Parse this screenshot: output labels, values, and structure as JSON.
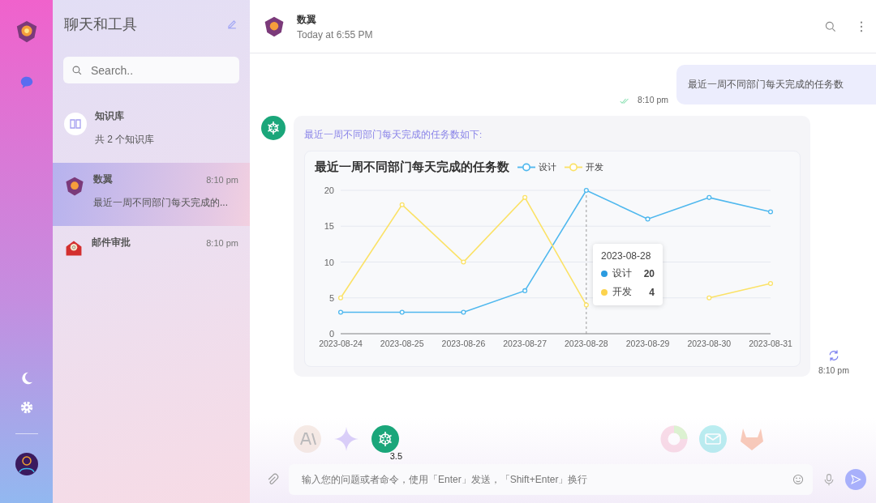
{
  "sidebar": {
    "title": "聊天和工具",
    "search": {
      "placeholder": "Search.."
    },
    "items": [
      {
        "kind": "knowledge",
        "title": "知识库",
        "subtitle": "共 2 个知识库",
        "selected": false
      },
      {
        "kind": "bot",
        "title": "数翼",
        "time": "8:10 pm",
        "subtitle": "最近一周不同部门每天完成的...",
        "selected": true
      },
      {
        "kind": "mail",
        "title": "邮件审批",
        "time": "8:10 pm",
        "selected": false
      }
    ]
  },
  "header": {
    "title": "数翼",
    "subtitle": "Today at 6:55 PM"
  },
  "messages": [
    {
      "kind": "user",
      "text": "最近一周不同部门每天完成的任务数",
      "time": "8:10 pm"
    },
    {
      "kind": "bot",
      "intro": "最近一周不同部门每天完成的任务数如下:",
      "time": "8:10 pm",
      "chart_data": {
        "type": "line",
        "title": "最近一周不同部门每天完成的任务数",
        "categories": [
          "2023-08-24",
          "2023-08-25",
          "2023-08-26",
          "2023-08-27",
          "2023-08-28",
          "2023-08-29",
          "2023-08-30",
          "2023-08-31"
        ],
        "series": [
          {
            "name": "设计",
            "color": "#4fb8ee",
            "values": [
              3,
              3,
              3,
              6,
              20,
              16,
              19,
              17
            ],
            "marker": "circle"
          },
          {
            "name": "开发",
            "color": "#fbe267",
            "values": [
              5,
              18,
              10,
              19,
              4,
              null,
              5,
              7
            ],
            "marker": "circle"
          }
        ],
        "ylim": [
          0,
          20
        ],
        "yticks": [
          0,
          5,
          10,
          15,
          20
        ],
        "grid": true,
        "legend": "top",
        "ref_lines": [
          {
            "axis": "x",
            "value": "2023-08-28"
          }
        ]
      },
      "tooltip": {
        "title": "2023-08-28",
        "rows": [
          {
            "name": "设计",
            "value": "20",
            "color": "#2b9be0"
          },
          {
            "name": "开发",
            "value": "4",
            "color": "#fcd34d"
          }
        ]
      }
    }
  ],
  "models": [
    {
      "kind": "claude",
      "selected": false
    },
    {
      "kind": "gemini",
      "selected": false
    },
    {
      "kind": "gpt",
      "selected": true,
      "badge": "3.5"
    },
    {
      "kind": "ring",
      "selected": false
    },
    {
      "kind": "mail",
      "selected": false
    },
    {
      "kind": "fox",
      "selected": false
    }
  ],
  "composer": {
    "placeholder": "输入您的问题或者命令，使用「Enter」发送，「Shift+Enter」换行"
  }
}
